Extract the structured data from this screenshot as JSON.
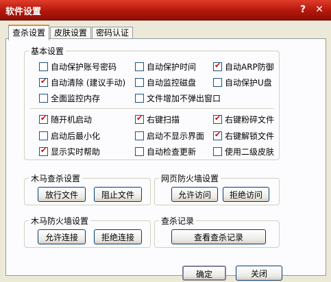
{
  "window": {
    "title": "软件设置",
    "help_glyph": "?",
    "close_glyph": "✕"
  },
  "tabs": [
    {
      "label": "查杀设置",
      "active": true
    },
    {
      "label": "皮肤设置",
      "active": false
    },
    {
      "label": "密码认证",
      "active": false
    }
  ],
  "basic": {
    "legend": "基本设置",
    "options": [
      {
        "label": "自动保护账号密码",
        "checked": false
      },
      {
        "label": "自动保护时间",
        "checked": false
      },
      {
        "label": "自动ARP防御",
        "checked": true
      },
      {
        "label": "自动清除 (建议手动)",
        "checked": true
      },
      {
        "label": "自动监控磁盘",
        "checked": false
      },
      {
        "label": "自动保护U盘",
        "checked": false
      },
      {
        "label": "全面监控内存",
        "checked": false
      },
      {
        "label": "文件增加不弹出窗口",
        "checked": false
      },
      {
        "label": "随开机启动",
        "checked": true
      },
      {
        "label": "右键扫描",
        "checked": true
      },
      {
        "label": "右键粉碎文件",
        "checked": true
      },
      {
        "label": "启动后最小化",
        "checked": false
      },
      {
        "label": "启动不显示界面",
        "checked": false
      },
      {
        "label": "右键解锁文件",
        "checked": true
      },
      {
        "label": "显示实时帮助",
        "checked": true
      },
      {
        "label": "自动检查更新",
        "checked": false
      },
      {
        "label": "使用二级皮肤",
        "checked": false
      }
    ]
  },
  "trojan_scan": {
    "legend": "木马查杀设置",
    "buttons": [
      "放行文件",
      "阻止文件"
    ]
  },
  "web_firewall": {
    "legend": "网页防火墙设置",
    "buttons": [
      "允许访问",
      "拒绝访问"
    ]
  },
  "trojan_firewall": {
    "legend": "木马防火墙设置",
    "buttons": [
      "允许连接",
      "拒绝连接"
    ]
  },
  "scan_log": {
    "legend": "查杀记录",
    "button": "查看查杀记录"
  },
  "footer": {
    "ok": "确定",
    "close": "关闭"
  },
  "colors": {
    "titlebar": "#c0200f",
    "accent_check": "#d40000",
    "tab_highlight": "#e68b2c"
  }
}
